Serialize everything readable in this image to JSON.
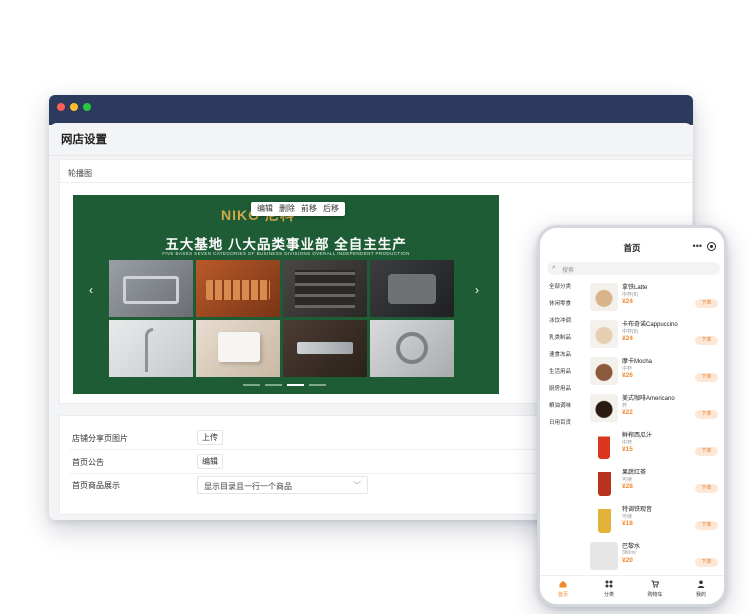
{
  "window": {
    "page_title": "网店设置",
    "carousel": {
      "section_label": "轮播图",
      "toolbar": [
        "编辑",
        "删除",
        "前移",
        "后移"
      ],
      "banner": {
        "logo_text": "NIKO 尼科",
        "headline": "五大基地 八大品类事业部 全自主生产",
        "subline": "FIVE BASES SEVEN CATEGORIES OF BUSINESS DIVISIONS OVERALL INDEPENDENT PRODUCTION",
        "prev_arrow": "‹",
        "next_arrow": "›",
        "slide_count": 4,
        "active_slide": 3
      }
    },
    "settings": [
      {
        "label": "店铺分享页图片",
        "control": "上传"
      },
      {
        "label": "首页公告",
        "control": "编辑"
      },
      {
        "label": "首页商品展示",
        "select_value": "显示目录且一行一个商品",
        "chevron": "﹀"
      }
    ]
  },
  "phone": {
    "title": "首页",
    "more_icon": "•••",
    "search_placeholder": "搜索",
    "search_icon": "⌕",
    "categories": [
      "全部分类",
      "休闲零食",
      "冰饮冲调",
      "乳类制品",
      "速食冻品",
      "生活用品",
      "厨房用品",
      "粮油调味",
      "日用百货"
    ],
    "products": [
      {
        "name": "拿铁Latte",
        "spec": "中杯(8)",
        "price": "¥24",
        "action": "下单"
      },
      {
        "name": "卡布奇诺Cappuccino",
        "spec": "中杯(8)",
        "price": "¥24",
        "action": "下单"
      },
      {
        "name": "摩卡Mocha",
        "spec": "中杯",
        "price": "¥26",
        "action": "下单"
      },
      {
        "name": "美式咖啡Americano",
        "spec": "杯",
        "price": "¥22",
        "action": "下单"
      },
      {
        "name": "鲜榨西瓜汁",
        "spec": "中杯",
        "price": "¥15",
        "action": "下单"
      },
      {
        "name": "果蔬红茶",
        "spec": "可续",
        "price": "¥28",
        "action": "下单"
      },
      {
        "name": "特调铁观音",
        "spec": "可续",
        "price": "¥18",
        "action": "下单"
      },
      {
        "name": "巴黎水",
        "spec": "380ml",
        "price": "¥20",
        "action": "下单"
      }
    ],
    "tabs": [
      "首页",
      "分类",
      "购物车",
      "我的"
    ],
    "accent_color": "#f08a2c"
  }
}
